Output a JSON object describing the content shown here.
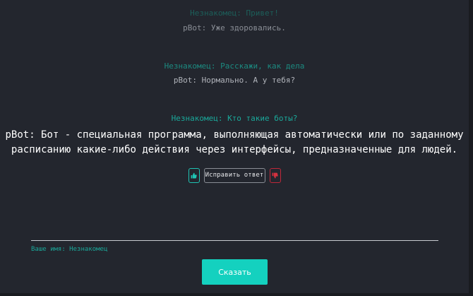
{
  "chat": {
    "messages": [
      {
        "speaker": "user",
        "text": "Незнакомец: Привет!"
      },
      {
        "speaker": "bot",
        "text": "pBot: Уже здоровались."
      },
      {
        "speaker": "user",
        "text": "Незнакомец: Расскажи, как дела"
      },
      {
        "speaker": "bot",
        "text": "pBot: Нормально. А у тебя?"
      },
      {
        "speaker": "user",
        "text": "Незнакомец: Кто такие боты?"
      },
      {
        "speaker": "bot",
        "text_line1": "pBot: Бот - специальная программа, выполняющая автоматически или по заданному",
        "text_line2": "расписанию какие-либо действия через интерфейсы, предназначенные для людей."
      }
    ]
  },
  "feedback": {
    "like_icon": "thumbs-up-icon",
    "dislike_icon": "thumbs-down-icon",
    "fix_label": "Исправить ответ"
  },
  "form": {
    "name_label": "Ваше имя: Незнакомец",
    "send_label": "Сказать"
  },
  "colors": {
    "background": "#23262e",
    "accent": "#14d1bf",
    "user_text": "#1aa89a",
    "dislike": "#c0283a"
  }
}
